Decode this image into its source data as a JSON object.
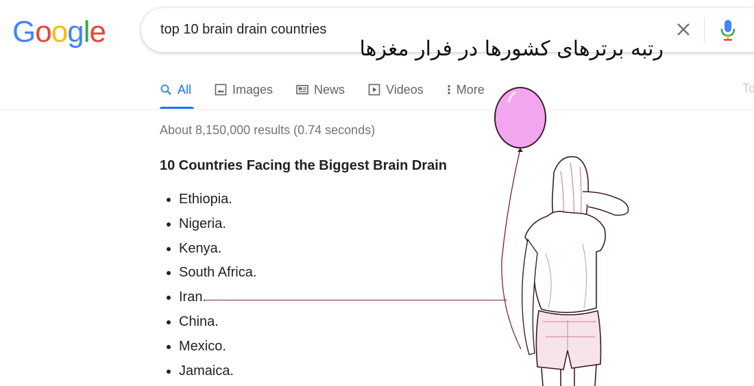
{
  "logo": {
    "letters": [
      "G",
      "o",
      "o",
      "g",
      "l",
      "e"
    ],
    "colors": [
      "#4285F4",
      "#EA4335",
      "#FBBC05",
      "#4285F4",
      "#34A853",
      "#EA4335"
    ]
  },
  "search": {
    "query": "top 10 brain drain countries"
  },
  "overlay_title": "رتبه برترهای کشورها در فرار مغزها",
  "tabs": [
    {
      "label": "All",
      "icon": "search-icon",
      "active": true
    },
    {
      "label": "Images",
      "icon": "image-icon"
    },
    {
      "label": "News",
      "icon": "news-icon"
    },
    {
      "label": "Videos",
      "icon": "video-icon"
    },
    {
      "label": "More",
      "icon": "more-vert-icon"
    }
  ],
  "tools_label": "To",
  "stats": "About 8,150,000 results (0.74 seconds)",
  "snippet": {
    "title": "10 Countries Facing the Biggest Brain Drain",
    "items": [
      "Ethiopia.",
      "Nigeria.",
      "Kenya.",
      "South Africa.",
      "Iran.",
      "China.",
      "Mexico.",
      "Jamaica."
    ]
  },
  "colors": {
    "accent": "#1a73e8",
    "balloon": "#f2a6ef"
  }
}
